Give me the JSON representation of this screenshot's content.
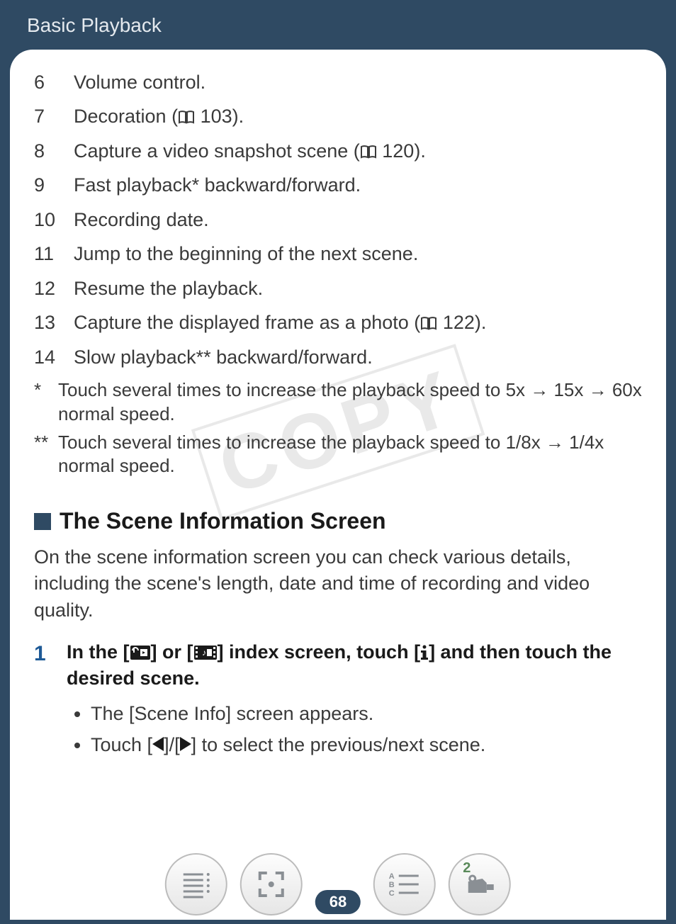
{
  "header": {
    "title": "Basic Playback"
  },
  "watermark": "COPY",
  "list": [
    {
      "num": "6",
      "text": "Volume control."
    },
    {
      "num": "7",
      "text_before": "Decoration (",
      "ref": "103",
      "text_after": ")."
    },
    {
      "num": "8",
      "text_before": "Capture a video snapshot scene (",
      "ref": "120",
      "text_after": ")."
    },
    {
      "num": "9",
      "text": "Fast playback* backward/forward."
    },
    {
      "num": "10",
      "text": "Recording date."
    },
    {
      "num": "11",
      "text": "Jump to the beginning of the next scene."
    },
    {
      "num": "12",
      "text": "Resume the playback."
    },
    {
      "num": "13",
      "text_before": "Capture the displayed frame as a photo (",
      "ref": "122",
      "text_after": ")."
    },
    {
      "num": "14",
      "text": "Slow playback** backward/forward."
    }
  ],
  "footnotes": [
    {
      "mark": "*",
      "text": "Touch several times to increase the playback speed to 5x → 15x → 60x normal speed."
    },
    {
      "mark": "**",
      "text": "Touch several times to increase the playback speed to 1/8x → 1/4x normal speed."
    }
  ],
  "section": {
    "title": "The Scene Information Screen",
    "intro": "On the scene information screen you can check various details, including the scene's length, date and time of recording and video quality.",
    "step_num": "1",
    "step_a": "In the [",
    "step_b": "] or [",
    "step_c": "] index screen, touch [",
    "step_d": "] and then touch the desired scene.",
    "bullets": [
      "The [Scene Info] screen appears.",
      "Touch [◀]/[▶] to select the previous/next scene."
    ]
  },
  "page_number": "68",
  "nav_icons": [
    "toc-icon",
    "expand-icon",
    "glossary-icon",
    "camera-icon"
  ],
  "nav_badge": "2"
}
